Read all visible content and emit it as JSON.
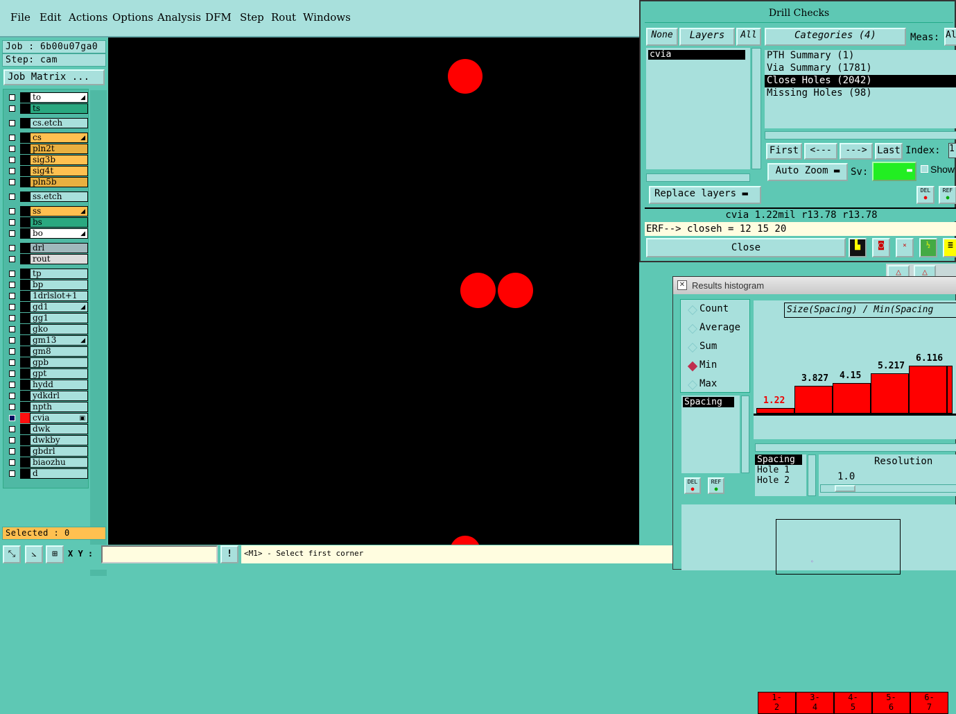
{
  "menu": [
    "File",
    "Edit",
    "Actions",
    "Options",
    "Analysis",
    "DFM",
    "Step",
    "Rout",
    "Windows"
  ],
  "left": {
    "job": "Job : 6b00u07ga0",
    "step": "Step: cam",
    "job_matrix": "Job Matrix ...",
    "selected": "Selected : 0"
  },
  "layers": [
    {
      "name": "to",
      "color": "#ffffff",
      "mark": "◢"
    },
    {
      "name": "ts",
      "color": "#2aa880",
      "mark": ""
    },
    {
      "name": "cs.etch",
      "color": "#a8e0dc",
      "mark": ""
    },
    {
      "name": "cs",
      "color": "#ffc050",
      "mark": "◢"
    },
    {
      "name": "pln2t",
      "color": "#e8b040",
      "mark": ""
    },
    {
      "name": "sig3b",
      "color": "#ffc050",
      "mark": ""
    },
    {
      "name": "sig4t",
      "color": "#ffc050",
      "mark": ""
    },
    {
      "name": "pln5b",
      "color": "#e8b040",
      "mark": ""
    },
    {
      "name": "ss.etch",
      "color": "#a8e0dc",
      "mark": ""
    },
    {
      "name": "ss",
      "color": "#ffc050",
      "mark": "◢"
    },
    {
      "name": "bs",
      "color": "#2aa880",
      "mark": ""
    },
    {
      "name": "bo",
      "color": "#ffffff",
      "mark": "◢"
    },
    {
      "name": "drl",
      "color": "#a0b8bc",
      "mark": ""
    },
    {
      "name": "rout",
      "color": "#dcdcdc",
      "mark": ""
    },
    {
      "name": "tp",
      "color": "#a8e0dc",
      "mark": ""
    },
    {
      "name": "bp",
      "color": "#a8e0dc",
      "mark": ""
    },
    {
      "name": "1drlslot+1",
      "color": "#a8e0dc",
      "mark": ""
    },
    {
      "name": "gd1",
      "color": "#a8e0dc",
      "mark": "◢"
    },
    {
      "name": "gg1",
      "color": "#a8e0dc",
      "mark": ""
    },
    {
      "name": "gko",
      "color": "#a8e0dc",
      "mark": ""
    },
    {
      "name": "gm13",
      "color": "#a8e0dc",
      "mark": "◢"
    },
    {
      "name": "gm8",
      "color": "#a8e0dc",
      "mark": ""
    },
    {
      "name": "gpb",
      "color": "#a8e0dc",
      "mark": ""
    },
    {
      "name": "gpt",
      "color": "#a8e0dc",
      "mark": ""
    },
    {
      "name": "hydd",
      "color": "#a8e0dc",
      "mark": ""
    },
    {
      "name": "ydkdrl",
      "color": "#a8e0dc",
      "mark": ""
    },
    {
      "name": "npth",
      "color": "#a8e0dc",
      "mark": ""
    },
    {
      "name": "cvia",
      "color": "#a8e0dc",
      "mark": "▣"
    },
    {
      "name": "dwk",
      "color": "#a8e0dc",
      "mark": ""
    },
    {
      "name": "dwkby",
      "color": "#a8e0dc",
      "mark": ""
    },
    {
      "name": "gbdrl",
      "color": "#a8e0dc",
      "mark": ""
    },
    {
      "name": "biaozhu",
      "color": "#a8e0dc",
      "mark": ""
    },
    {
      "name": "d",
      "color": "#a8e0dc",
      "mark": ""
    }
  ],
  "bottom": {
    "xy_label": "X Y :",
    "xy_value": "",
    "status": "<M1> - Select first corner"
  },
  "drill": {
    "title": "Drill Checks",
    "none": "None",
    "layers": "Layers",
    "all": "All",
    "categories": "Categories (4)",
    "meas": "Meas:",
    "meas_val": "Al",
    "layer_items": [
      "cvia"
    ],
    "category_items": [
      "PTH Summary (1)",
      "Via Summary (1781)",
      "Close Holes (2042)",
      "Missing Holes (98)"
    ],
    "first": "First",
    "prev": "<---",
    "next": "--->",
    "last": "Last",
    "index": "Index:",
    "index_val": "1",
    "auto_zoom": "Auto Zoom",
    "sv": "Sv:",
    "show": "Show",
    "replace_layers": "Replace layers",
    "info": "cvia 1.22mil   r13.78   r13.78",
    "erf": "ERF--> closeh = 12 15 20",
    "close": "Close",
    "del": "DEL",
    "ref": "REF"
  },
  "hist": {
    "title": "Results histogram",
    "modes": [
      "Count",
      "Average",
      "Sum",
      "Min",
      "Max"
    ],
    "selected_mode": "Min",
    "header": "Size(Spacing) / Min(Spacing",
    "list1": [
      "Spacing"
    ],
    "list2": [
      "Spacing",
      "Hole 1",
      "Hole 2"
    ],
    "resolution": "Resolution",
    "resolution_val": "1.0",
    "del": "DEL",
    "ref": "REF"
  },
  "chart_data": {
    "type": "bar",
    "categories": [
      "1-2",
      "3-4",
      "4-5",
      "5-6",
      "6-7"
    ],
    "values": [
      1.22,
      3.827,
      4.15,
      5.217,
      6.116
    ],
    "labels": [
      "1.22",
      "3.827",
      "4.15",
      "5.217",
      "6.116"
    ],
    "title": "Size(Spacing) / Min(Spacing",
    "highlight_color": "#ff0000"
  }
}
